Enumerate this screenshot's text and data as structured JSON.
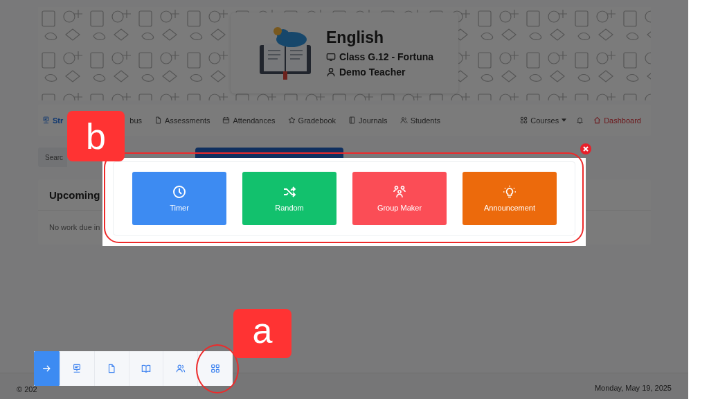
{
  "banner": {
    "course_title": "English",
    "class_name": "Class G.12 - Fortuna",
    "teacher": "Demo Teacher"
  },
  "nav": {
    "items": [
      {
        "label": "Str",
        "kind": "presentation",
        "selected": true
      },
      {
        "label": "bus",
        "kind": "none",
        "selected": false
      },
      {
        "label": "Assessments",
        "kind": "file",
        "selected": false
      },
      {
        "label": "Attendances",
        "kind": "calendar",
        "selected": false
      },
      {
        "label": "Gradebook",
        "kind": "star",
        "selected": false
      },
      {
        "label": "Journals",
        "kind": "journal",
        "selected": false
      },
      {
        "label": "Students",
        "kind": "users",
        "selected": false
      }
    ],
    "courses": "Courses",
    "dashboard": "Dashboard"
  },
  "search": {
    "placeholder": "Searc"
  },
  "upcoming": {
    "title": "Upcoming",
    "empty_text": "No work due in"
  },
  "tools_modal": {
    "tools": [
      {
        "label": "Timer",
        "kind": "timer",
        "color": "#3d8bf2"
      },
      {
        "label": "Random",
        "kind": "random",
        "color": "#12c16d"
      },
      {
        "label": "Group Maker",
        "kind": "group",
        "color": "#fb4d56"
      },
      {
        "label": "Announcement",
        "kind": "announcement",
        "color": "#ec6a0c"
      }
    ]
  },
  "quick_toolbar": {
    "buttons": [
      {
        "kind": "arrow",
        "selected": true
      },
      {
        "kind": "presentation",
        "selected": false
      },
      {
        "kind": "file",
        "selected": false
      },
      {
        "kind": "book",
        "selected": false
      },
      {
        "kind": "users",
        "selected": false
      },
      {
        "kind": "grid",
        "selected": false
      }
    ]
  },
  "footer": {
    "copyright": "© 202",
    "date": "Monday, May 19, 2025"
  },
  "annotations": [
    {
      "kind": "b",
      "letter": "b"
    },
    {
      "kind": "a",
      "letter": "a"
    }
  ]
}
